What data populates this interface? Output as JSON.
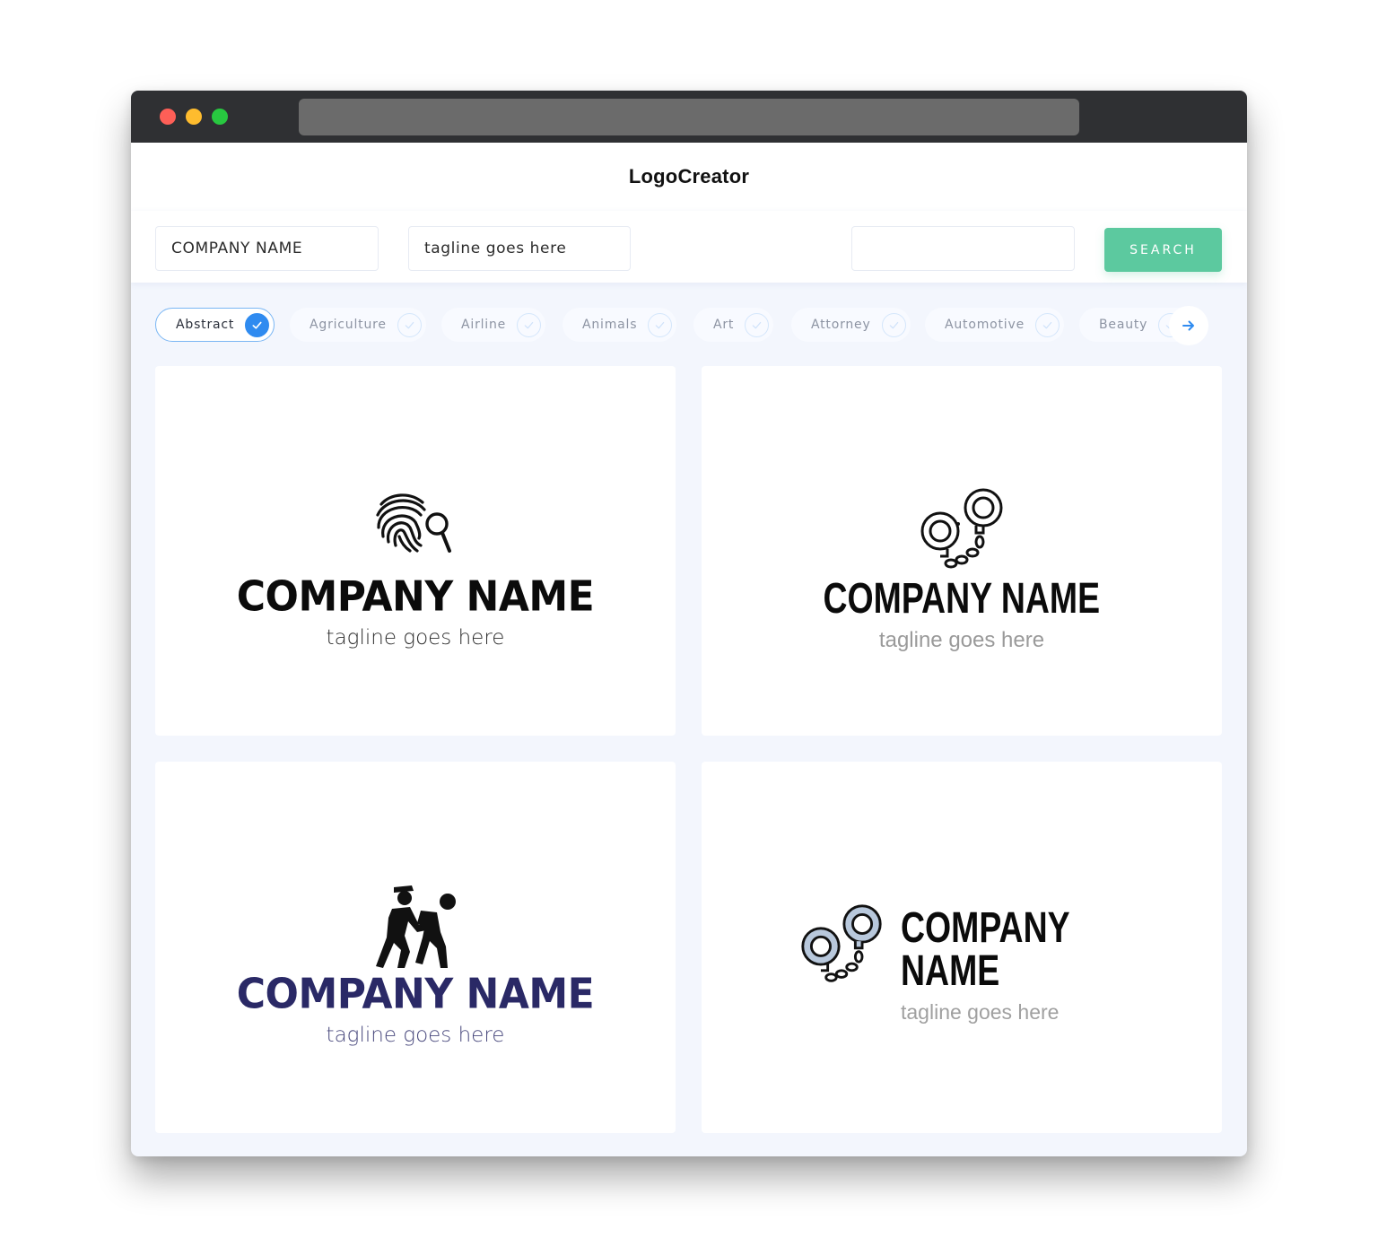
{
  "app": {
    "title": "LogoCreator"
  },
  "search": {
    "company_value": "COMPANY NAME",
    "tagline_value": "tagline goes here",
    "extra_value": "",
    "button_label": "SEARCH"
  },
  "categories": [
    {
      "label": "Abstract",
      "selected": true
    },
    {
      "label": "Agriculture",
      "selected": false
    },
    {
      "label": "Airline",
      "selected": false
    },
    {
      "label": "Animals",
      "selected": false
    },
    {
      "label": "Art",
      "selected": false
    },
    {
      "label": "Attorney",
      "selected": false
    },
    {
      "label": "Automotive",
      "selected": false
    },
    {
      "label": "Beauty",
      "selected": false
    }
  ],
  "colors": {
    "accent_green": "#5cc99f",
    "accent_blue": "#2f8bf0",
    "navy": "#2a2966",
    "handcuff_fill": "#b8c8dc"
  },
  "logos": [
    {
      "icon": "fingerprint-magnifier-icon",
      "name": "COMPANY NAME",
      "tagline": "tagline goes here"
    },
    {
      "icon": "handcuffs-outline-icon",
      "name": "COMPANY NAME",
      "tagline": "tagline goes here"
    },
    {
      "icon": "police-arrest-icon",
      "name": "COMPANY NAME",
      "tagline": "tagline goes here"
    },
    {
      "icon": "handcuffs-colored-icon",
      "name": "COMPANY NAME",
      "tagline": "tagline goes here"
    }
  ]
}
